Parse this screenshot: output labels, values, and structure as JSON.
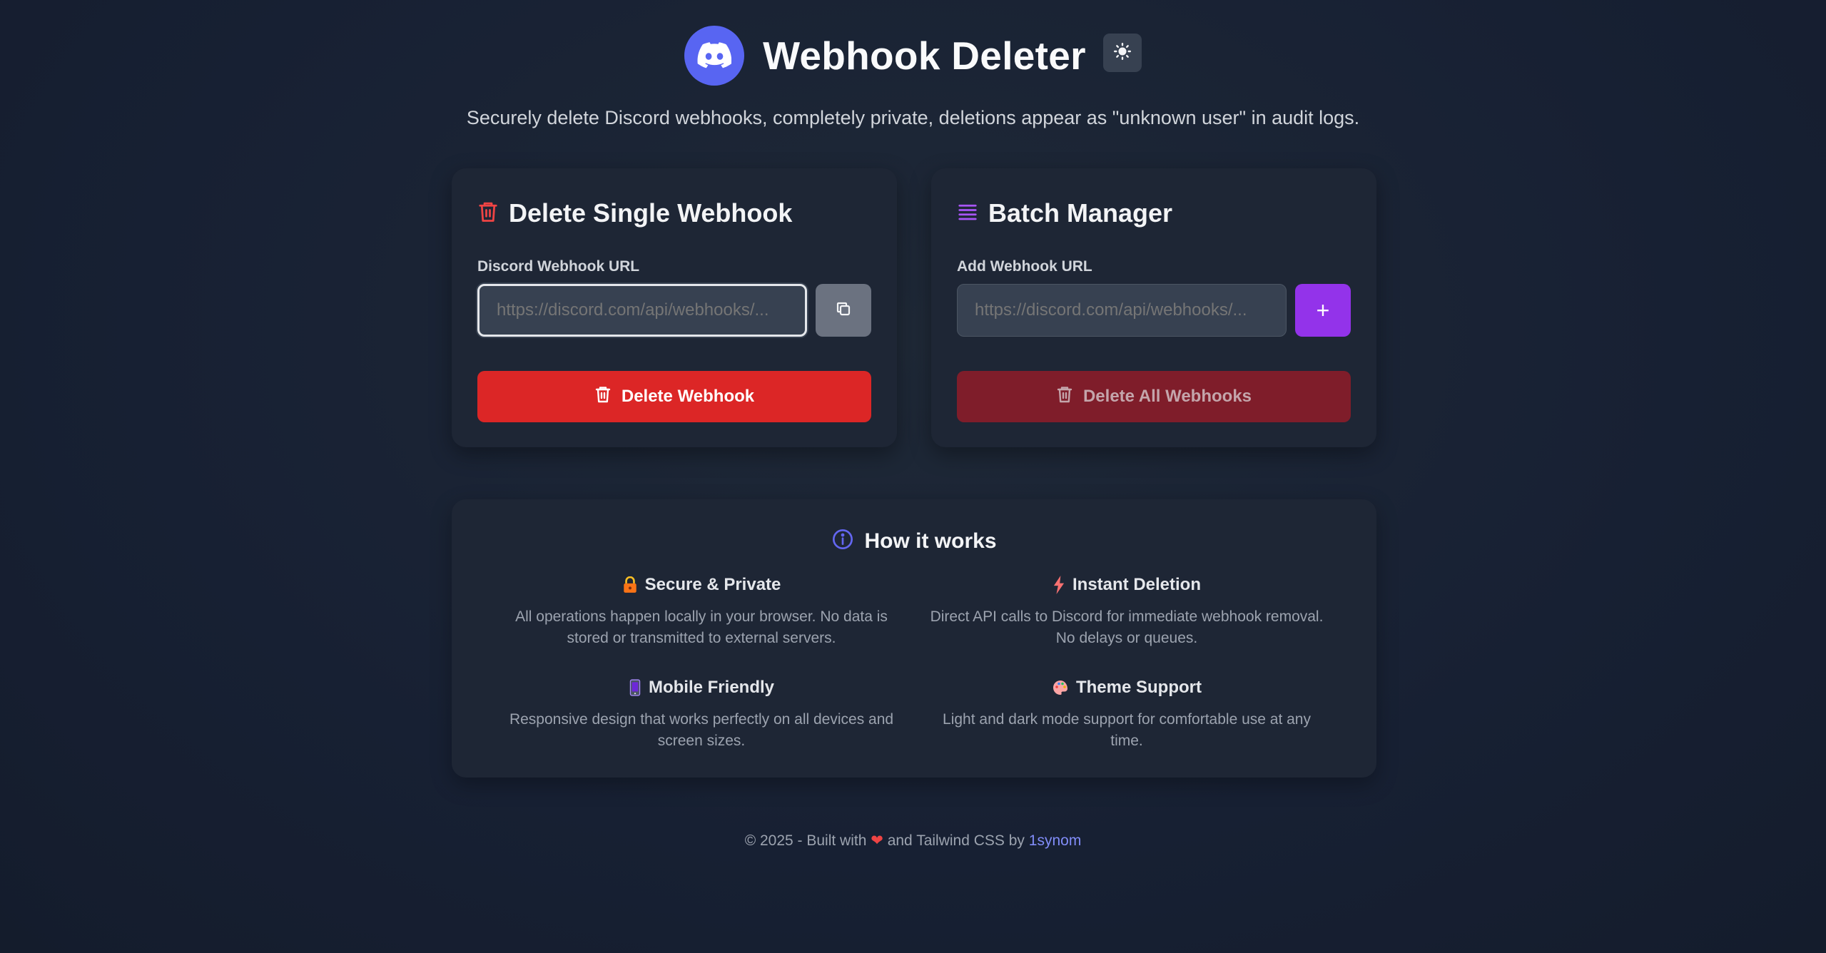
{
  "header": {
    "title": "Webhook Deleter",
    "subtitle": "Securely delete Discord webhooks, completely private, deletions appear as \"unknown user\" in audit logs.",
    "logo_icon": "discord-icon",
    "theme_toggle_icon": "sun-icon"
  },
  "single": {
    "heading": "Delete Single Webhook",
    "heading_icon": "trash-icon",
    "field_label": "Discord Webhook URL",
    "placeholder": "https://discord.com/api/webhooks/...",
    "value": "",
    "copy_icon": "copy-icon",
    "button_label": "Delete Webhook"
  },
  "batch": {
    "heading": "Batch Manager",
    "heading_icon": "list-icon",
    "field_label": "Add Webhook URL",
    "placeholder": "https://discord.com/api/webhooks/...",
    "value": "",
    "add_label": "+",
    "button_label": "Delete All Webhooks"
  },
  "how": {
    "title": "How it works",
    "title_icon": "info-icon",
    "features": [
      {
        "icon": "lock-icon",
        "title": "Secure & Private",
        "desc": "All operations happen locally in your browser. No data is stored or transmitted to external servers."
      },
      {
        "icon": "lightning-icon",
        "title": "Instant Deletion",
        "desc": "Direct API calls to Discord for immediate webhook removal. No delays or queues."
      },
      {
        "icon": "mobile-icon",
        "title": "Mobile Friendly",
        "desc": "Responsive design that works perfectly on all devices and screen sizes."
      },
      {
        "icon": "palette-icon",
        "title": "Theme Support",
        "desc": "Light and dark mode support for comfortable use at any time."
      }
    ]
  },
  "footer": {
    "prefix": "© 2025 - Built with",
    "heart": "❤",
    "middle": "and Tailwind CSS by",
    "author": "1synom"
  },
  "colors": {
    "background": "#1b2332",
    "card": "#1e2635",
    "discord_blurple": "#5865f2",
    "danger": "#dc2626",
    "purple": "#9333ea",
    "link": "#818cf8"
  }
}
